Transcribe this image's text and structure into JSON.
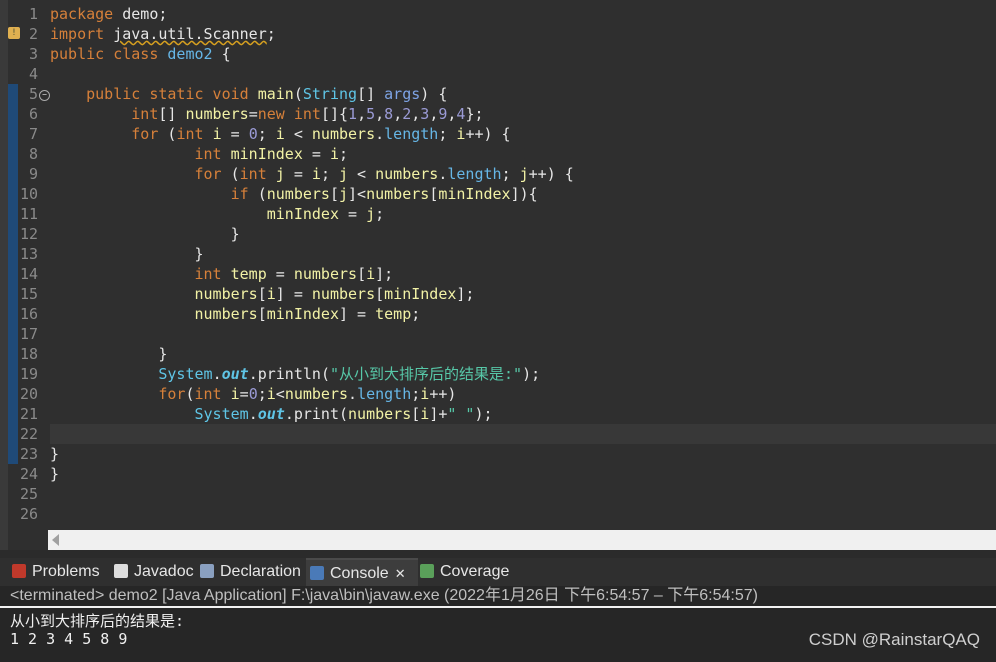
{
  "editor": {
    "line_numbers": [
      "1",
      "2",
      "3",
      "4",
      "5",
      "6",
      "7",
      "8",
      "9",
      "10",
      "11",
      "12",
      "13",
      "14",
      "15",
      "16",
      "17",
      "18",
      "19",
      "20",
      "21",
      "22",
      "23",
      "24",
      "25",
      "26"
    ],
    "lines": [
      {
        "html": "<span class='kw'>package</span> demo;"
      },
      {
        "html": "<span class='kw'>import</span> <span class='sq'>java.util.Scanner</span>;"
      },
      {
        "html": "<span class='kw'>public class</span> <span class='fld'>demo2</span> {"
      },
      {
        "html": ""
      },
      {
        "html": "    <span class='kw'>public static void</span> <span class='var'>main</span>(<span class='sysc'>String</span>[] <span class='prm'>args</span>) {"
      },
      {
        "html": "         <span class='ty'>int</span>[] <span class='var'>numbers</span>=<span class='kw'>new</span> <span class='ty'>int</span>[]{<span class='num'>1</span>,<span class='num'>5</span>,<span class='num'>8</span>,<span class='num'>2</span>,<span class='num'>3</span>,<span class='num'>9</span>,<span class='num'>4</span>};"
      },
      {
        "html": "         <span class='kw'>for</span> (<span class='ty'>int</span> <span class='var'>i</span> = <span class='num'>0</span>; <span class='var'>i</span> &lt; <span class='var'>numbers</span>.<span class='fld'>length</span>; <span class='var'>i</span>++) {"
      },
      {
        "html": "                <span class='ty'>int</span> <span class='var'>minIndex</span> = <span class='var'>i</span>;"
      },
      {
        "html": "                <span class='kw'>for</span> (<span class='ty'>int</span> <span class='var'>j</span> = <span class='var'>i</span>; <span class='var'>j</span> &lt; <span class='var'>numbers</span>.<span class='fld'>length</span>; <span class='var'>j</span>++) {"
      },
      {
        "html": "                    <span class='kw'>if</span> (<span class='var'>numbers</span>[<span class='var'>j</span>]&lt;<span class='var'>numbers</span>[<span class='var'>minIndex</span>]){"
      },
      {
        "html": "                        <span class='var'>minIndex</span> = <span class='var'>j</span>;"
      },
      {
        "html": "                    }"
      },
      {
        "html": "                }"
      },
      {
        "html": "                <span class='ty'>int</span> <span class='var'>temp</span> = <span class='var'>numbers</span>[<span class='var'>i</span>];"
      },
      {
        "html": "                <span class='var'>numbers</span>[<span class='var'>i</span>] = <span class='var'>numbers</span>[<span class='var'>minIndex</span>];"
      },
      {
        "html": "                <span class='var'>numbers</span>[<span class='var'>minIndex</span>] = <span class='var'>temp</span>;"
      },
      {
        "html": ""
      },
      {
        "html": "            }"
      },
      {
        "html": "            <span class='sysc'>System</span>.<span class='out'>out</span>.<span class='mth'>println</span>(<span class='str'>\"从小到大排序后的结果是:\"</span>);"
      },
      {
        "html": "            <span class='kw'>for</span>(<span class='ty'>int</span> <span class='var'>i</span>=<span class='num'>0</span>;<span class='var'>i</span>&lt;<span class='var'>numbers</span>.<span class='fld'>length</span>;<span class='var'>i</span>++)"
      },
      {
        "html": "                <span class='sysc'>System</span>.<span class='out'>out</span>.<span class='mth'>print</span>(<span class='var'>numbers</span>[<span class='var'>i</span>]+<span class='str'>\" \"</span>);"
      },
      {
        "html": "",
        "current": true
      },
      {
        "html": "}"
      },
      {
        "html": "}"
      },
      {
        "html": ""
      },
      {
        "html": ""
      }
    ],
    "fold_marker": "−",
    "warning_icon": "warning-icon"
  },
  "tabs": [
    {
      "label": "Problems",
      "icon": "problems-icon",
      "color": "#c0392b"
    },
    {
      "label": "Javadoc",
      "icon": "javadoc-icon",
      "color": "#dddddd"
    },
    {
      "label": "Declaration",
      "icon": "declaration-icon",
      "color": "#8aa0c0"
    },
    {
      "label": "Console",
      "icon": "console-icon",
      "color": "#4a7ab8",
      "active": true,
      "close": "✕"
    },
    {
      "label": "Coverage",
      "icon": "coverage-icon",
      "color": "#5aa05a"
    }
  ],
  "console": {
    "status": "<terminated> demo2 [Java Application] F:\\java\\bin\\javaw.exe  (2022年1月26日 下午6:54:57 – 下午6:54:57)",
    "output": [
      "从小到大排序后的结果是:",
      "1 2 3 4 5 8 9"
    ]
  },
  "watermark": "CSDN @RainstarQAQ"
}
